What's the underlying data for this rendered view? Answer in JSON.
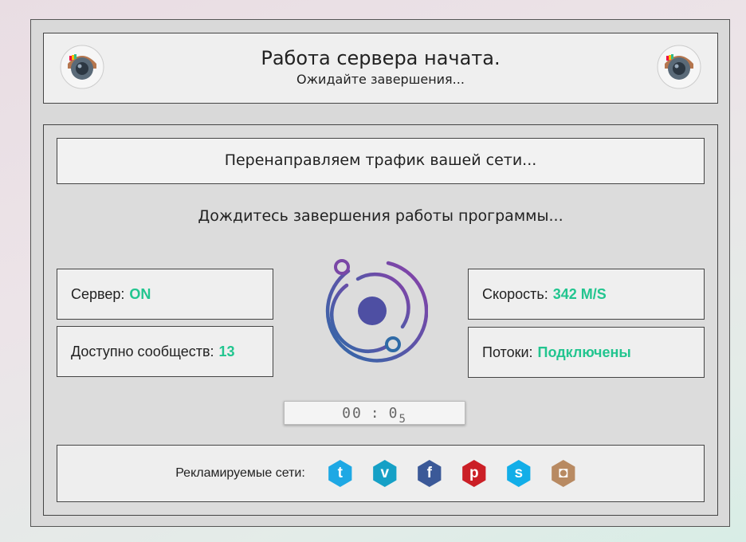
{
  "header": {
    "title": "Работа сервера начата.",
    "subtitle": "Ожидайте завершения..."
  },
  "banner": {
    "text": "Перенаправляем трафик вашей сети..."
  },
  "status_text": "Дождитесь завершения работы программы...",
  "stats": {
    "server_label": "Сервер:",
    "server_value": "ON",
    "communities_label": "Доступно сообществ:",
    "communities_value": "13",
    "speed_label": "Скорость:",
    "speed_value": "342 M/S",
    "threads_label": "Потоки:",
    "threads_value": "Подключены"
  },
  "timer": {
    "d1": "0",
    "d2": "0",
    "sep": ":",
    "d3": "0",
    "d4": "5"
  },
  "footer": {
    "label": "Рекламируемые сети:",
    "networks": [
      {
        "icon": "twitter-icon",
        "glyph": "t",
        "color": "#1ea8e4"
      },
      {
        "icon": "vimeo-icon",
        "glyph": "v",
        "color": "#15a0c6"
      },
      {
        "icon": "facebook-icon",
        "glyph": "f",
        "color": "#3b5998"
      },
      {
        "icon": "pinterest-icon",
        "glyph": "p",
        "color": "#cb1f26"
      },
      {
        "icon": "skype-icon",
        "glyph": "s",
        "color": "#12aee8"
      },
      {
        "icon": "instagram-icon",
        "glyph": "◘",
        "color": "#b88a62"
      }
    ]
  },
  "colors": {
    "accent_value": "#22c58f",
    "logo_gradient_start": "#2d6aa8",
    "logo_gradient_end": "#8a3fa8"
  }
}
